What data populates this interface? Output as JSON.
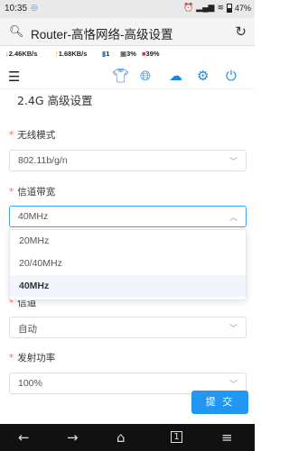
{
  "status_bar": {
    "time": "10:35",
    "battery": "47%"
  },
  "browser": {
    "url_title": "Router-高恪网络-高级设置"
  },
  "info_bar": {
    "download": "2.46KB/s",
    "upload": "1.68KB/s",
    "clients": "1",
    "cpu": "3%",
    "memory": "39%"
  },
  "toolbar": {
    "icons": [
      "menu-icon",
      "shirt-icon",
      "globe-icon",
      "cloud-upload-icon",
      "gear-icon",
      "power-icon"
    ]
  },
  "section": {
    "title": "2.4G 高级设置"
  },
  "fields": {
    "wireless_mode": {
      "label": "无线模式",
      "value": "802.11b/g/n"
    },
    "channel_width": {
      "label": "信道带宽",
      "value": "40MHz"
    },
    "channel": {
      "label": "信道",
      "value": "自动"
    },
    "tx_power": {
      "label": "发射功率",
      "value": "100%"
    }
  },
  "dropdown": {
    "options": [
      "20MHz",
      "20/40MHz",
      "40MHz"
    ],
    "selected": "40MHz"
  },
  "actions": {
    "submit": "提 交"
  },
  "colors": {
    "accent": "#1e88e5",
    "required": "#f56c6c",
    "button": "#2196f3"
  }
}
